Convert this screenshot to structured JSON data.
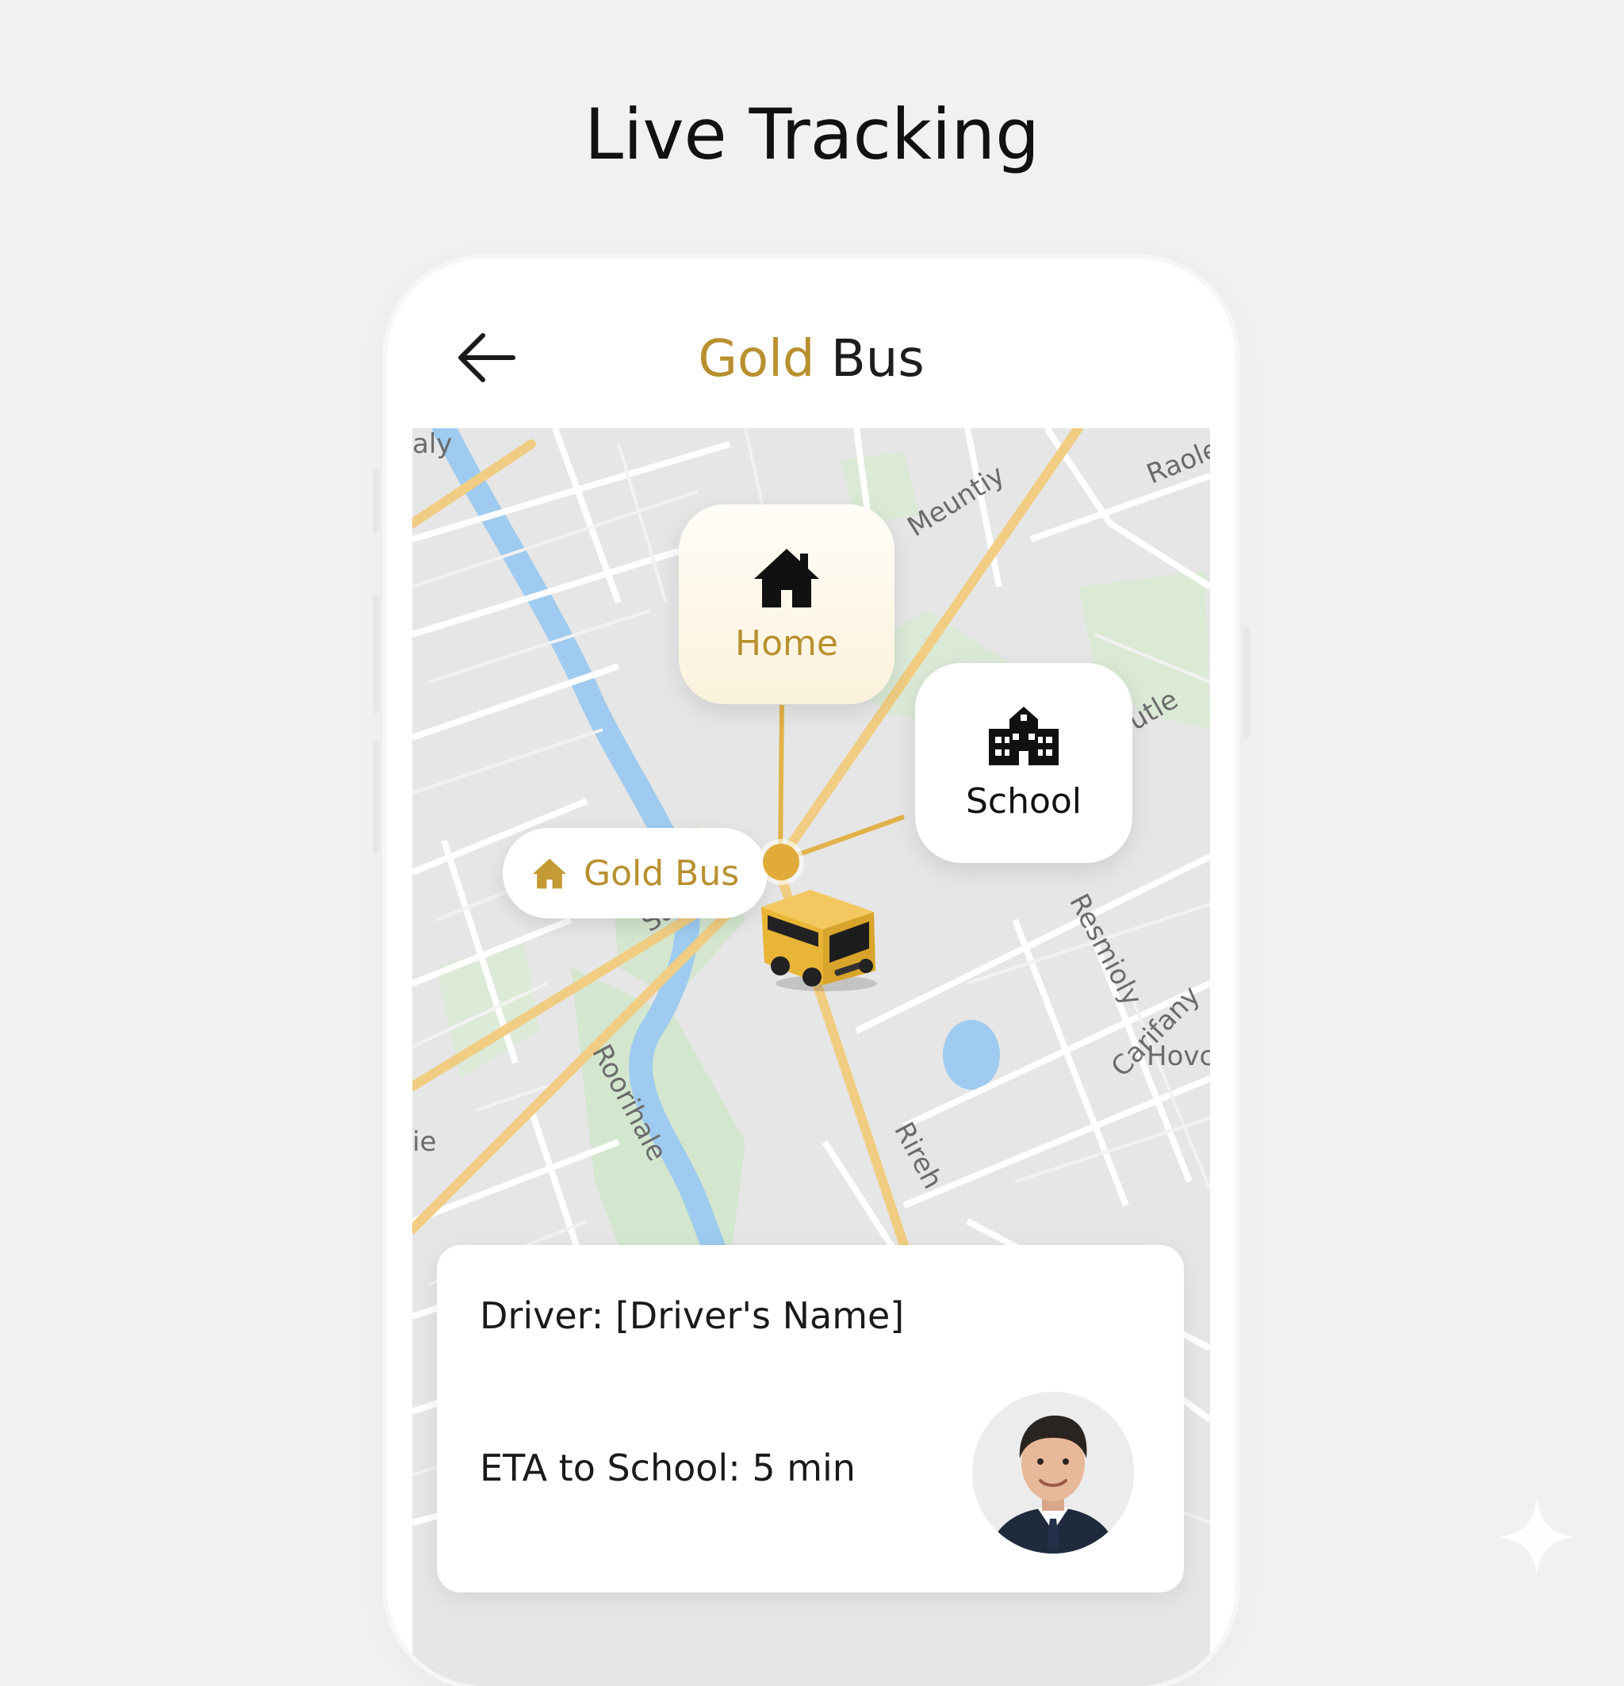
{
  "page": {
    "heading": "Live Tracking"
  },
  "app": {
    "title_gold": "Gold",
    "title_rest": " Bus"
  },
  "map": {
    "street_labels": [
      "aly",
      "Meuntiy",
      "Raole",
      "utle",
      "Saritee",
      "Resmioly",
      "Carifany",
      "Hovc",
      "Roorihale",
      "Rireh",
      "ie"
    ],
    "markers": {
      "home_label": "Home",
      "school_label": "School",
      "bus_pill_label": "Gold Bus"
    }
  },
  "trip": {
    "driver_text": "Driver: [Driver's Name]",
    "eta_text": "ETA to School: 5 min"
  },
  "colors": {
    "gold": "#b8902f",
    "route": "#e2b24a",
    "river": "#9ecbef",
    "park": "#cfe6c9"
  },
  "icons": {
    "back": "arrow-left-icon",
    "home": "house-icon",
    "school": "school-building-icon",
    "bus": "school-bus-icon"
  }
}
